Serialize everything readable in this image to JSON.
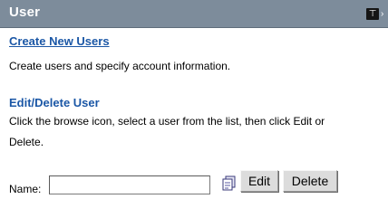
{
  "panel": {
    "title": "User",
    "title_buttons": [
      "⊤",
      "›"
    ]
  },
  "create_section": {
    "link_label": "Create New Users",
    "description": "Create users and specify account information."
  },
  "edit_section": {
    "heading": "Edit/Delete User",
    "instructions_line1": "Click the browse icon, select a user from the list, then click Edit or",
    "instructions_line2": "Delete."
  },
  "form": {
    "name_label": "Name:",
    "name_value": "",
    "browse_icon": "browse-icon",
    "edit_label": "Edit",
    "delete_label": "Delete"
  },
  "colors": {
    "titlebar": "#7d8c9b",
    "link": "#1b57a6"
  }
}
